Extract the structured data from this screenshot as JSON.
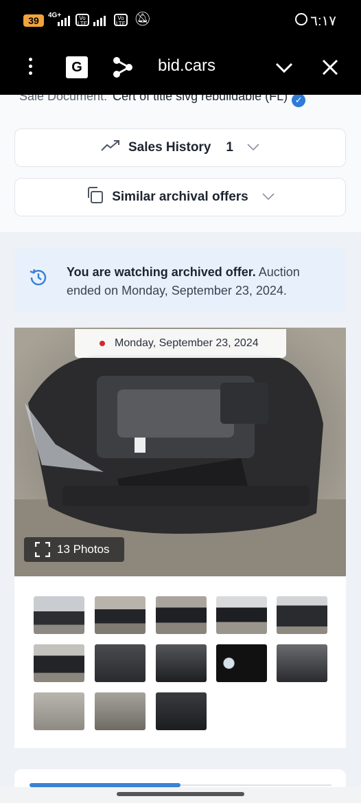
{
  "status_bar": {
    "battery": "39",
    "network": "4G+",
    "volte_label": "Vo LTE",
    "time": "٦:١٧"
  },
  "browser": {
    "url": "bid.cars",
    "menu_icon": "more-vert-icon",
    "translate_icon": "translate-icon",
    "share_icon": "share-icon",
    "collapse_icon": "chevron-down-icon",
    "close_icon": "close-icon"
  },
  "sale_document": {
    "label": "Sale Document:",
    "value": "Cert of title slvg rebuildable (FL)"
  },
  "sales_history": {
    "label": "Sales History",
    "count": "1"
  },
  "similar_offers": {
    "label": "Similar archival offers"
  },
  "notice": {
    "bold": "You are watching archived offer.",
    "rest": " Auction ended on Monday, September 23, 2024."
  },
  "photo": {
    "date": "Monday, September 23, 2024",
    "photos_label": "13 Photos"
  },
  "thumbnails": [
    {
      "name": "thumb-front-left"
    },
    {
      "name": "thumb-side"
    },
    {
      "name": "thumb-rear-left"
    },
    {
      "name": "thumb-rear-right"
    },
    {
      "name": "thumb-front"
    },
    {
      "name": "thumb-rear"
    },
    {
      "name": "thumb-interior-front"
    },
    {
      "name": "thumb-dashboard"
    },
    {
      "name": "thumb-gauges"
    },
    {
      "name": "thumb-rear-seats"
    },
    {
      "name": "thumb-engine"
    },
    {
      "name": "thumb-parts"
    },
    {
      "name": "thumb-fuse-box"
    }
  ],
  "colors": {
    "accent": "#3b82d6",
    "notice_bg": "#e8f1fb",
    "status_dot": "#d32a2a",
    "battery": "#f1a33b"
  }
}
